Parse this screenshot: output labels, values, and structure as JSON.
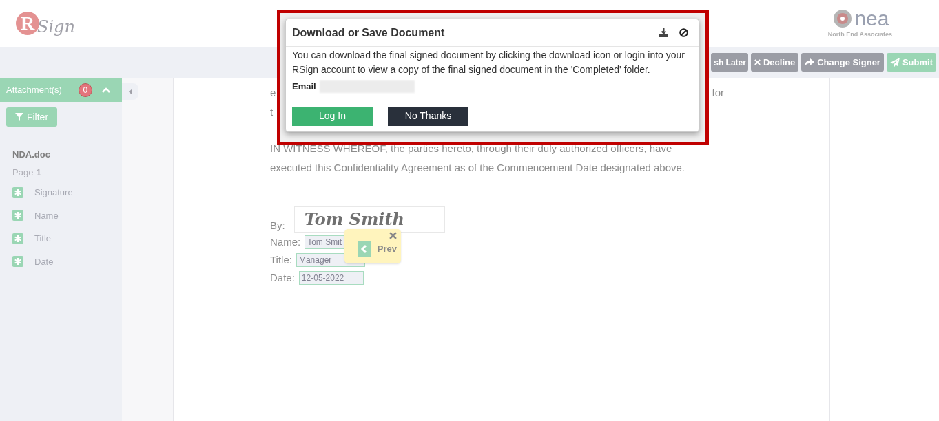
{
  "header": {
    "logo": {
      "initial": "R",
      "script": "Sign"
    },
    "partner_logo": {
      "name": "nea",
      "subtitle": "North End Associates"
    }
  },
  "toolbar": {
    "buttons": [
      {
        "label": "sh Later",
        "kind": "gray"
      },
      {
        "label": "Decline",
        "kind": "gray"
      },
      {
        "label": "Change Signer",
        "kind": "gray"
      },
      {
        "label": "Submit",
        "kind": "green"
      }
    ]
  },
  "sidebar": {
    "title": "Attachment(s)",
    "count": "0",
    "expanded": true,
    "filter": "Filter",
    "document": "NDA.doc",
    "page_label": "Page",
    "page_number": "1",
    "fields": [
      {
        "label": "Signature"
      },
      {
        "label": "Name"
      },
      {
        "label": "Title"
      },
      {
        "label": "Date"
      }
    ]
  },
  "document": {
    "partial_left": "e",
    "partial_right": "for",
    "partial_line": "t",
    "paragraph": "IN WITNESS WHEREOF, the parties hereto, through their duly authorized officers, have executed this Confidentiality Agreement as of the Commencement Date designated above.",
    "by_label": "By:",
    "signature": "Tom Smith",
    "fields": [
      {
        "label": "Name:",
        "value": "Tom Smit"
      },
      {
        "label": "Title:",
        "value": "Manager"
      },
      {
        "label": "Date:",
        "value": "12-05-2022"
      }
    ],
    "tooltip": {
      "button": "Prev"
    }
  },
  "modal": {
    "title": "Download or Save Document",
    "message": "You can download the final signed document by clicking the download icon or login into your RSign account to view a copy of the final signed document in the 'Completed' folder.",
    "email_label": "Email",
    "buttons": [
      {
        "label": "Log In",
        "kind": "primary"
      },
      {
        "label": "No Thanks",
        "kind": "dark"
      }
    ]
  }
}
